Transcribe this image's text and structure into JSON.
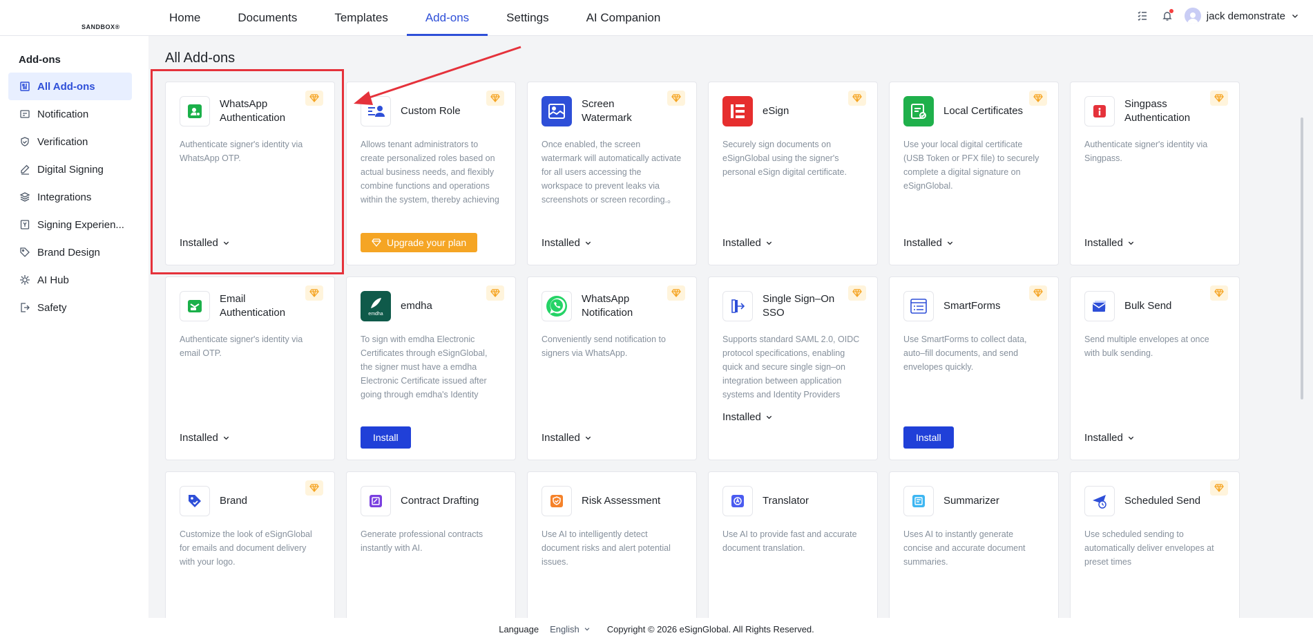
{
  "brand": {
    "logo_text": "SANDBOX®"
  },
  "nav": {
    "tabs": [
      {
        "label": "Home"
      },
      {
        "label": "Documents"
      },
      {
        "label": "Templates"
      },
      {
        "label": "Add-ons"
      },
      {
        "label": "Settings"
      },
      {
        "label": "AI Companion"
      }
    ],
    "active": "Add-ons",
    "user_name": "jack demonstrate"
  },
  "sidebar": {
    "title": "Add-ons",
    "items": [
      {
        "label": "All Add-ons",
        "icon": "grid-icon"
      },
      {
        "label": "Notification",
        "icon": "message-icon"
      },
      {
        "label": "Verification",
        "icon": "shield-icon"
      },
      {
        "label": "Digital Signing",
        "icon": "pen-icon"
      },
      {
        "label": "Integrations",
        "icon": "layers-icon"
      },
      {
        "label": "Signing Experien...",
        "icon": "bookmark-icon"
      },
      {
        "label": "Brand Design",
        "icon": "tag-icon"
      },
      {
        "label": "AI Hub",
        "icon": "ai-icon"
      },
      {
        "label": "Safety",
        "icon": "exit-icon"
      }
    ]
  },
  "main": {
    "title": "All Add-ons",
    "cards": [
      {
        "title": "WhatsApp Authentication",
        "desc": "Authenticate signer's identity via WhatsApp OTP.",
        "status": "Installed",
        "icon": "whatsapp-auth-icon"
      },
      {
        "title": "Custom Role",
        "desc": "Allows tenant administrators to create personalized roles based on actual business needs, and flexibly combine functions and operations within the system, thereby achieving fine–grained control ov...",
        "action": "Upgrade your plan",
        "icon": "custom-role-icon"
      },
      {
        "title": "Screen Watermark",
        "desc": "Once enabled, the screen watermark will automatically activate for all users accessing the workspace to prevent leaks via screenshots or screen recording.。",
        "status": "Installed",
        "icon": "watermark-icon"
      },
      {
        "title": "eSign",
        "desc": "Securely sign documents on eSignGlobal using the signer's personal eSign digital certificate.",
        "status": "Installed",
        "icon": "esign-icon"
      },
      {
        "title": "Local Certificates",
        "desc": "Use your local digital certificate (USB Token or PFX file) to securely complete a digital signature on eSignGlobal.",
        "status": "Installed",
        "icon": "certificate-icon"
      },
      {
        "title": "Singpass Authentication",
        "desc": "Authenticate signer's identity via Singpass.",
        "status": "Installed",
        "icon": "singpass-icon"
      },
      {
        "title": "Email Authentication",
        "desc": "Authenticate signer's identity via email OTP.",
        "status": "Installed",
        "icon": "email-auth-icon"
      },
      {
        "title": "emdha",
        "desc": "To sign with emdha Electronic Certificates through eSignGlobal, the signer must have a emdha Electronic Certificate issued after going through emdha's Identity verification process.",
        "action": "Install",
        "icon": "emdha-icon",
        "icon_text": "emdha"
      },
      {
        "title": "WhatsApp Notification",
        "desc": "Conveniently send notification to signers via WhatsApp.",
        "status": "Installed",
        "icon": "whatsapp-icon"
      },
      {
        "title": "Single Sign–On SSO",
        "desc": "Supports standard SAML 2.0, OIDC protocol specifications, enabling quick and secure single sign–on integration between application systems and Identity Providers (such as Microsoft Ent...",
        "status": "Installed",
        "icon": "sso-icon"
      },
      {
        "title": "SmartForms",
        "desc": "Use SmartForms to collect data, auto–fill documents, and send envelopes quickly.",
        "action": "Install",
        "icon": "smartforms-icon"
      },
      {
        "title": "Bulk Send",
        "desc": "Send multiple envelopes at once with bulk sending.",
        "status": "Installed",
        "icon": "bulk-send-icon"
      },
      {
        "title": "Brand",
        "desc": "Customize the look of eSignGlobal for emails and document delivery with your logo.",
        "icon": "brand-icon"
      },
      {
        "title": "Contract Drafting",
        "desc": "Generate professional contracts instantly with AI.",
        "icon": "contract-icon"
      },
      {
        "title": "Risk Assessment",
        "desc": "Use AI to intelligently detect document risks and alert potential issues.",
        "icon": "risk-icon"
      },
      {
        "title": "Translator",
        "desc": "Use AI to provide fast and accurate document translation.",
        "icon": "translator-icon"
      },
      {
        "title": "Summarizer",
        "desc": "Uses AI to instantly generate concise and accurate document summaries.",
        "icon": "summarizer-icon"
      },
      {
        "title": "Scheduled Send",
        "desc": "Use scheduled sending to automatically deliver envelopes at preset times",
        "icon": "scheduled-send-icon"
      }
    ]
  },
  "footer": {
    "language_label": "Language",
    "language_value": "English",
    "copyright": "Copyright © 2026 eSignGlobal. All Rights Reserved."
  },
  "colors": {
    "accent": "#2e4fd8",
    "install_button": "#2040d8",
    "upgrade_button": "#f5a524",
    "highlight": "#e5323b"
  }
}
